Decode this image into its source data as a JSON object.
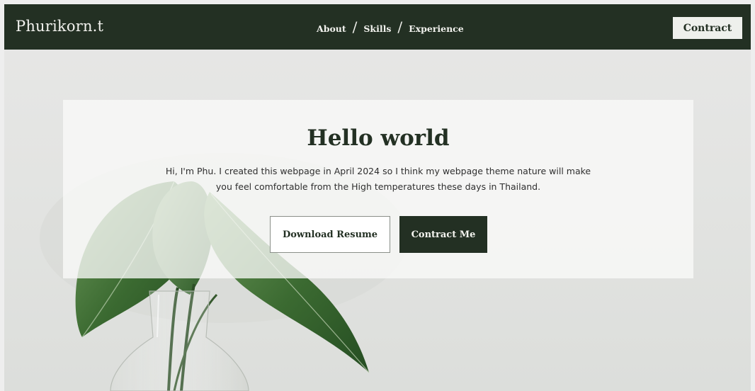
{
  "navbar": {
    "brand": "Phurikorn.t",
    "links": [
      "About",
      "Skills",
      "Experience"
    ],
    "separator": "/",
    "contract_button": "Contract"
  },
  "hero": {
    "title": "Hello world",
    "line1": "Hi, I'm Phu. I created this webpage in April 2024 so I think my webpage theme nature will make",
    "line2": "you feel comfortable from the High temperatures these days in Thailand.",
    "download_button": "Download Resume",
    "contact_button": "Contract Me"
  },
  "colors": {
    "primary": "#233023",
    "background": "#eeeeee",
    "card": "#fafaf9",
    "leaf": "#3f6b34"
  },
  "icons": {
    "background_photo": "plant-leaves-vase-image"
  }
}
